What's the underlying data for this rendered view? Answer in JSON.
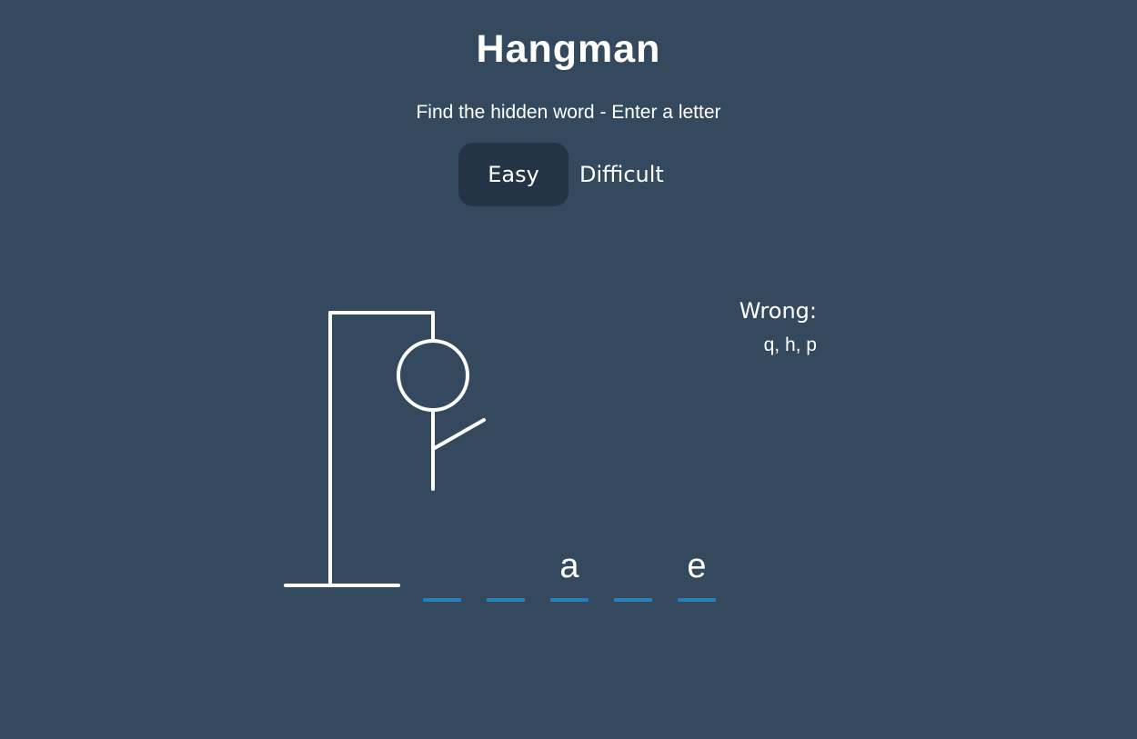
{
  "header": {
    "title": "Hangman",
    "subtitle": "Find the hidden word - Enter a letter"
  },
  "modes": {
    "easy_label": "Easy",
    "difficult_label": "Difficult",
    "selected": "Easy"
  },
  "wrong": {
    "label": "Wrong:",
    "letters": "q, h, p"
  },
  "word": {
    "letters": [
      "",
      "",
      "a",
      "",
      "e"
    ]
  },
  "figure": {
    "parts_shown": [
      "gallows",
      "head",
      "body",
      "right-arm"
    ]
  },
  "colors": {
    "background": "#34495e",
    "active_button": "#243446",
    "underline": "#2980b9",
    "text": "#ffffff"
  }
}
